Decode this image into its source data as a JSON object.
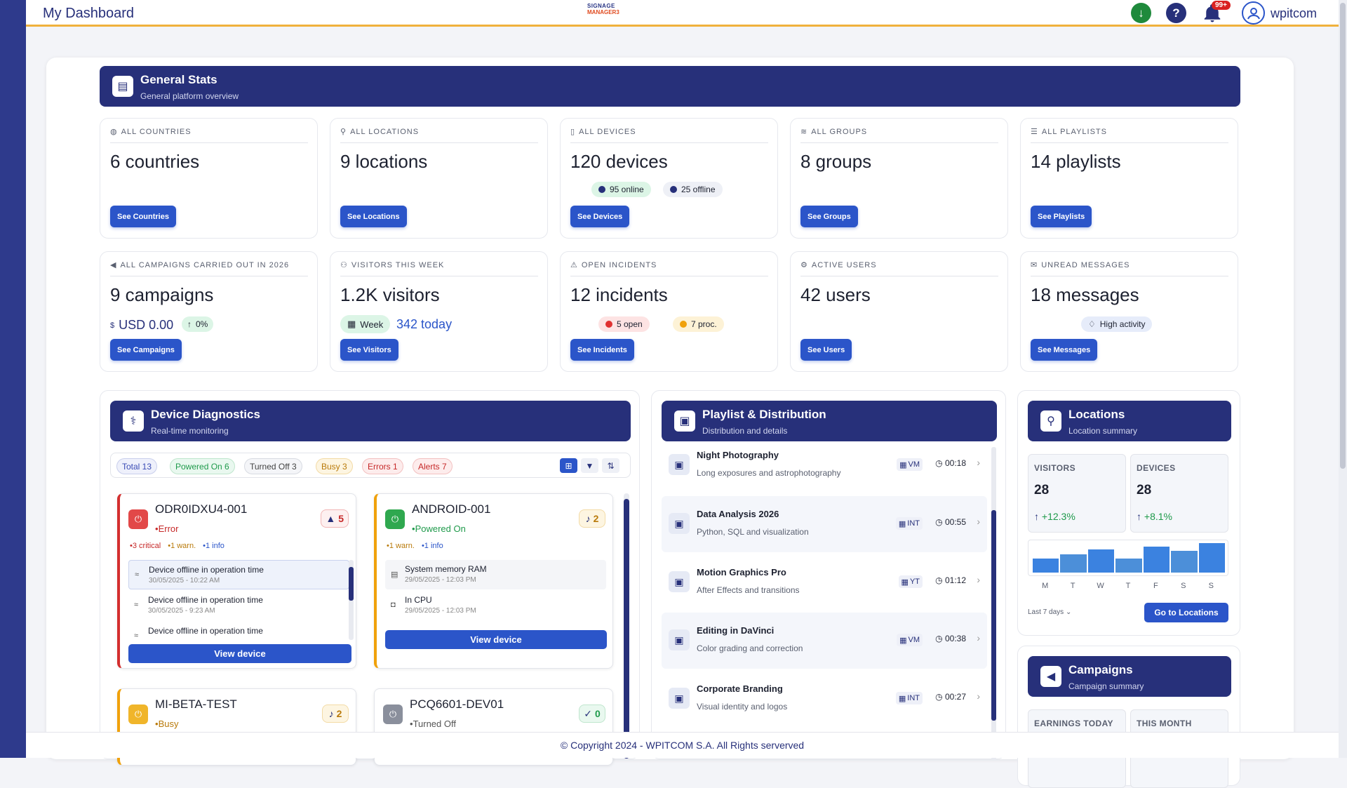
{
  "app": {
    "title": "My Dashboard",
    "logo_line1": "SIGNAGE",
    "logo_line2": "MANAGER3",
    "notifications_badge": "99+",
    "username": "wpitcom"
  },
  "general": {
    "title": "General Stats",
    "subtitle": "General platform overview"
  },
  "cards_row1": [
    {
      "label": "ALL COUNTRIES",
      "value": "6 countries",
      "button": "See Countries",
      "icon": "globe-icon"
    },
    {
      "label": "ALL LOCATIONS",
      "value": "9 locations",
      "button": "See Locations",
      "icon": "pin-icon"
    },
    {
      "label": "ALL DEVICES",
      "value": "120 devices",
      "button": "See Devices",
      "icon": "phone-icon",
      "online": "95 online",
      "offline": "25 offline"
    },
    {
      "label": "ALL GROUPS",
      "value": "8 groups",
      "button": "See Groups",
      "icon": "layers-icon"
    },
    {
      "label": "ALL PLAYLISTS",
      "value": "14 playlists",
      "button": "See Playlists",
      "icon": "list-icon"
    }
  ],
  "cards_row2": [
    {
      "label": "ALL CAMPAIGNS CARRIED OUT IN 2026",
      "value": "9 campaigns",
      "button": "See Campaigns",
      "icon": "megaphone-icon",
      "money_symbol": "$",
      "money": "USD 0.00",
      "trend": "0%"
    },
    {
      "label": "VISITORS THIS WEEK",
      "value": "1.2K visitors",
      "button": "See Visitors",
      "icon": "people-icon",
      "period": "Week",
      "today": "342 today"
    },
    {
      "label": "OPEN INCIDENTS",
      "value": "12 incidents",
      "button": "See Incidents",
      "icon": "warning-icon",
      "open": "5 open",
      "proc": "7 proc."
    },
    {
      "label": "ACTIVE USERS",
      "value": "42 users",
      "button": "See Users",
      "icon": "users-gear-icon"
    },
    {
      "label": "UNREAD MESSAGES",
      "value": "18 messages",
      "button": "See Messages",
      "icon": "envelope-icon",
      "activity": "High activity"
    }
  ],
  "diagnostics": {
    "title": "Device Diagnostics",
    "subtitle": "Real-time monitoring",
    "filters": [
      {
        "label": "Total 13",
        "color": "#3a4bb5"
      },
      {
        "label": "Powered On 6",
        "color": "#1f9a4b"
      },
      {
        "label": "Turned Off 3",
        "color": "#6c7280"
      },
      {
        "label": "Busy 3",
        "color": "#b97a0a"
      },
      {
        "label": "Errors 1",
        "color": "#c62828"
      },
      {
        "label": "Alerts 7",
        "color": "#c62828"
      }
    ],
    "devices": [
      {
        "name": "ODR0IDXU4-001",
        "status": "Error",
        "alerts": "5",
        "critical": "3 critical",
        "warn": "1 warn.",
        "info": "1 info",
        "events": [
          {
            "title": "Device offline in operation time",
            "date": "30/05/2025 - 10:22 AM"
          },
          {
            "title": "Device offline in operation time",
            "date": "30/05/2025 - 9:23 AM"
          },
          {
            "title": "Device offline in operation time",
            "date": ""
          }
        ],
        "view": "View device"
      },
      {
        "name": "ANDROID-001",
        "status": "Powered On",
        "alerts": "2",
        "warn": "1 warn.",
        "info": "1 info",
        "events": [
          {
            "title": "System memory RAM",
            "date": "29/05/2025 - 12:03 PM"
          },
          {
            "title": "In CPU",
            "date": "29/05/2025 - 12:03 PM"
          }
        ],
        "view": "View device"
      },
      {
        "name": "MI-BETA-TEST",
        "status": "Busy",
        "alerts": "2"
      },
      {
        "name": "PCQ6601-DEV01",
        "status": "Turned Off",
        "alerts": "0"
      }
    ]
  },
  "playlist": {
    "title": "Playlist & Distribution",
    "subtitle": "Distribution and details",
    "items": [
      {
        "title": "Night Photography",
        "desc": "Long exposures and astrophotography",
        "tag": "VM",
        "time": "00:18"
      },
      {
        "title": "Data Analysis 2026",
        "desc": "Python, SQL and visualization",
        "tag": "INT",
        "time": "00:55"
      },
      {
        "title": "Motion Graphics Pro",
        "desc": "After Effects and transitions",
        "tag": "YT",
        "time": "01:12"
      },
      {
        "title": "Editing in DaVinci",
        "desc": "Color grading and correction",
        "tag": "VM",
        "time": "00:38"
      },
      {
        "title": "Corporate Branding",
        "desc": "Visual identity and logos",
        "tag": "INT",
        "time": "00:27"
      }
    ]
  },
  "locations": {
    "title": "Locations",
    "subtitle": "Location summary",
    "visitors_label": "VISITORS",
    "visitors": "28",
    "visitors_trend": "+12.3%",
    "devices_label": "DEVICES",
    "devices": "28",
    "devices_trend": "+8.1%",
    "days": [
      "M",
      "T",
      "W",
      "T",
      "F",
      "S",
      "S"
    ],
    "bars": [
      0.45,
      0.6,
      0.75,
      0.45,
      0.85,
      0.7,
      0.95
    ],
    "range": "Last 7 days",
    "button": "Go to Locations"
  },
  "campaigns": {
    "title": "Campaigns",
    "subtitle": "Campaign summary",
    "earnings_label": "EARNINGS TODAY",
    "month_label": "THIS MONTH"
  },
  "footer": {
    "text": "© Copyright 2024 - WPITCOM S.A. All Rights serverved"
  }
}
